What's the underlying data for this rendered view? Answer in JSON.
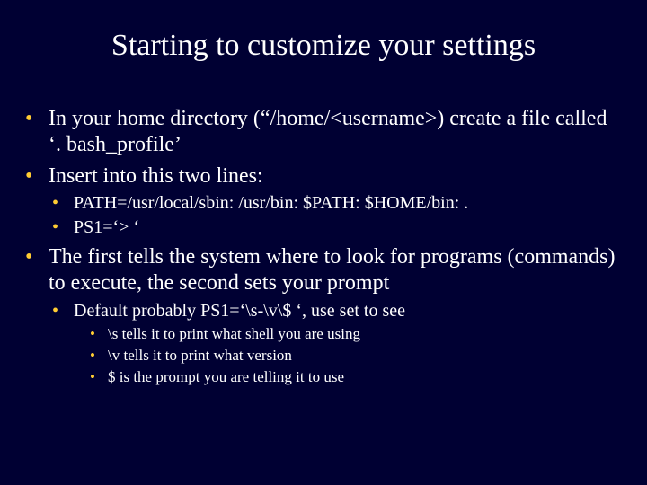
{
  "title": "Starting to customize your settings",
  "points": {
    "p1": "In your home directory (“/home/<username>) create a file called ‘. bash_profile’",
    "p2": "Insert into this two lines:",
    "p2a": "PATH=/usr/local/sbin: /usr/bin: $PATH: $HOME/bin: .",
    "p2b": "PS1=‘> ‘",
    "p3": "The first tells the system where to look for programs (commands) to execute, the second sets your prompt",
    "p3a": "Default probably PS1=‘\\s-\\v\\$ ‘, use set to see",
    "p3a1": "\\s tells it to print what shell you are using",
    "p3a2": "\\v tells it to print what version",
    "p3a3": "$ is the prompt you are telling it to use"
  }
}
